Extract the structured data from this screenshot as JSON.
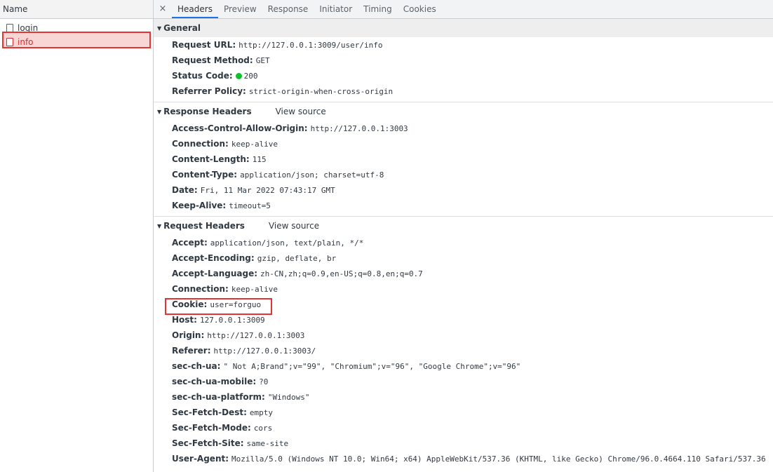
{
  "left": {
    "header": "Name",
    "requests": [
      {
        "name": "login",
        "selected": false
      },
      {
        "name": "info",
        "selected": true
      }
    ]
  },
  "tabs": {
    "close": "×",
    "items": [
      "Headers",
      "Preview",
      "Response",
      "Initiator",
      "Timing",
      "Cookies"
    ],
    "active": "Headers"
  },
  "general": {
    "title": "General",
    "rows": [
      {
        "key": "Request URL:",
        "value": "http://127.0.0.1:3009/user/info"
      },
      {
        "key": "Request Method:",
        "value": "GET"
      },
      {
        "key": "Status Code:",
        "value": "200"
      },
      {
        "key": "Referrer Policy:",
        "value": "strict-origin-when-cross-origin"
      }
    ]
  },
  "response_headers": {
    "title": "Response Headers",
    "view_source": "View source",
    "rows": [
      {
        "key": "Access-Control-Allow-Origin:",
        "value": "http://127.0.0.1:3003"
      },
      {
        "key": "Connection:",
        "value": "keep-alive"
      },
      {
        "key": "Content-Length:",
        "value": "115"
      },
      {
        "key": "Content-Type:",
        "value": "application/json; charset=utf-8"
      },
      {
        "key": "Date:",
        "value": "Fri, 11 Mar 2022 07:43:17 GMT"
      },
      {
        "key": "Keep-Alive:",
        "value": "timeout=5"
      }
    ]
  },
  "request_headers": {
    "title": "Request Headers",
    "view_source": "View source",
    "rows": [
      {
        "key": "Accept:",
        "value": "application/json, text/plain, */*"
      },
      {
        "key": "Accept-Encoding:",
        "value": "gzip, deflate, br"
      },
      {
        "key": "Accept-Language:",
        "value": "zh-CN,zh;q=0.9,en-US;q=0.8,en;q=0.7"
      },
      {
        "key": "Connection:",
        "value": "keep-alive"
      },
      {
        "key": "Cookie:",
        "value": "user=forguo"
      },
      {
        "key": "Host:",
        "value": "127.0.0.1:3009"
      },
      {
        "key": "Origin:",
        "value": "http://127.0.0.1:3003"
      },
      {
        "key": "Referer:",
        "value": "http://127.0.0.1:3003/"
      },
      {
        "key": "sec-ch-ua:",
        "value": "\" Not A;Brand\";v=\"99\", \"Chromium\";v=\"96\", \"Google Chrome\";v=\"96\""
      },
      {
        "key": "sec-ch-ua-mobile:",
        "value": "?0"
      },
      {
        "key": "sec-ch-ua-platform:",
        "value": "\"Windows\""
      },
      {
        "key": "Sec-Fetch-Dest:",
        "value": "empty"
      },
      {
        "key": "Sec-Fetch-Mode:",
        "value": "cors"
      },
      {
        "key": "Sec-Fetch-Site:",
        "value": "same-site"
      },
      {
        "key": "User-Agent:",
        "value": "Mozilla/5.0 (Windows NT 10.0; Win64; x64) AppleWebKit/537.36 (KHTML, like Gecko) Chrome/96.0.4664.110 Safari/537.36"
      }
    ]
  },
  "colors": {
    "status_ok": "#0ec22b",
    "annotation_red": "#e53232",
    "selected_text": "#dc2d2d",
    "tab_active_underline": "#1a73e8"
  }
}
